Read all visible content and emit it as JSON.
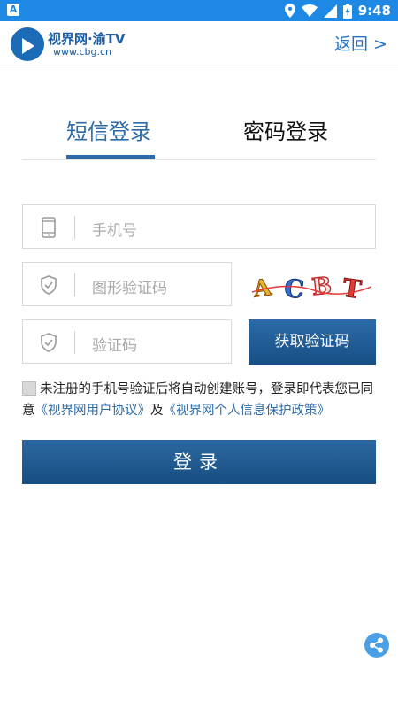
{
  "status_bar": {
    "time": "9:48",
    "left_icon": "A",
    "icons": [
      "location-icon",
      "wifi-icon",
      "signal-icon",
      "battery-icon"
    ]
  },
  "header": {
    "logo_name": "视界网·渝TV",
    "logo_url": "www.cbg.cn",
    "back_label": "返回 >"
  },
  "tabs": [
    {
      "label": "短信登录",
      "active": true
    },
    {
      "label": "密码登录",
      "active": false
    }
  ],
  "form": {
    "phone_placeholder": "手机号",
    "captcha_placeholder": "图形验证码",
    "captcha_text": "ACBT",
    "sms_code_placeholder": "验证码",
    "get_code_label": "获取验证码"
  },
  "agreement": {
    "text": "未注册的手机号验证后将自动创建账号，登录即代表您已同意",
    "link1": "《视界网用户协议》",
    "connector": "及",
    "link2": "《视界网个人信息保护政策》"
  },
  "login_label": "登录",
  "colors": {
    "status_bar": "#1e88e5",
    "accent": "#2d6ba8",
    "button": "#1f5c96",
    "link": "#2d6ba8"
  }
}
